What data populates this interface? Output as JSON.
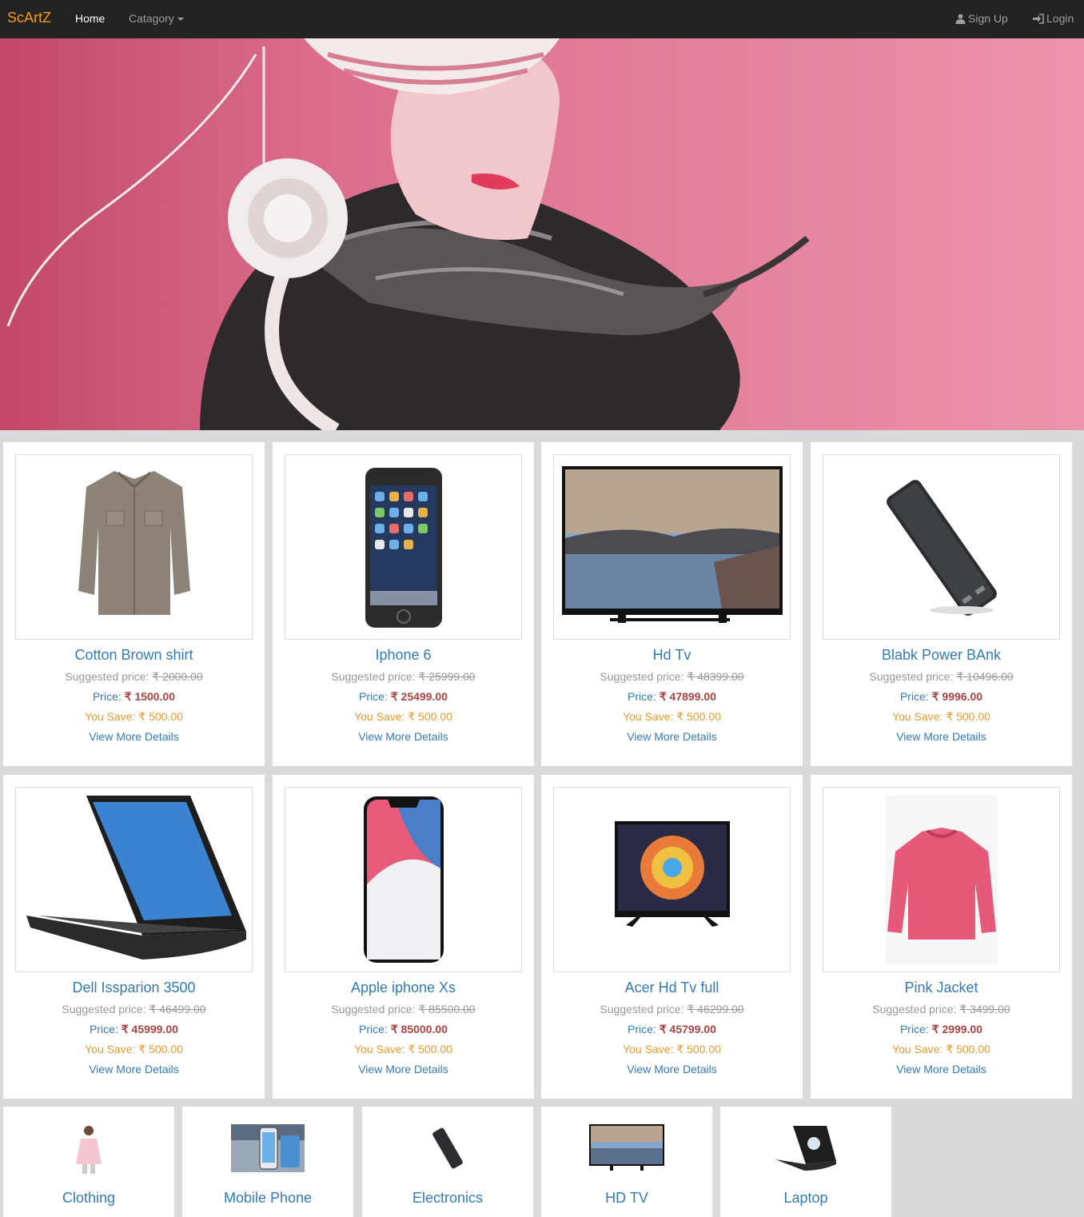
{
  "navbar": {
    "brand": "ScArtZ",
    "home": "Home",
    "category": "Catagory",
    "signup": "Sign Up",
    "login": "Login"
  },
  "hero": {
    "slide_count": 4,
    "active_slide": 0
  },
  "labels": {
    "suggested": "Suggested price:",
    "price": "Price:",
    "save": "You Save:",
    "more": "View More Details"
  },
  "products": [
    {
      "name": "Cotton Brown shirt",
      "suggested": "₹ 2000.00",
      "price": "₹ 1500.00",
      "save": "₹ 500.00",
      "icon": "shirt-image"
    },
    {
      "name": "Iphone 6",
      "suggested": "₹ 25999.00",
      "price": "₹ 25499.00",
      "save": "₹ 500.00",
      "icon": "phone-image"
    },
    {
      "name": "Hd Tv",
      "suggested": "₹ 48399.00",
      "price": "₹ 47899.00",
      "save": "₹ 500.00",
      "icon": "tv-image"
    },
    {
      "name": "Blabk Power BAnk",
      "suggested": "₹ 10496.00",
      "price": "₹ 9996.00",
      "save": "₹ 500.00",
      "icon": "powerbank-image"
    },
    {
      "name": "Dell Issparion 3500",
      "suggested": "₹ 46499.00",
      "price": "₹ 45999.00",
      "save": "₹ 500.00",
      "icon": "laptop-image"
    },
    {
      "name": "Apple iphone Xs",
      "suggested": "₹ 85500.00",
      "price": "₹ 85000.00",
      "save": "₹ 500.00",
      "icon": "iphone-x-image"
    },
    {
      "name": "Acer Hd Tv full",
      "suggested": "₹ 46299.00",
      "price": "₹ 45799.00",
      "save": "₹ 500.00",
      "icon": "tv-image"
    },
    {
      "name": "Pink Jacket",
      "suggested": "₹ 3499.00",
      "price": "₹ 2999.00",
      "save": "₹ 500.00",
      "icon": "jacket-image"
    }
  ],
  "categories": [
    {
      "label": "Clothing"
    },
    {
      "label": "Mobile Phone"
    },
    {
      "label": "Electronics"
    },
    {
      "label": "HD TV"
    },
    {
      "label": "Laptop"
    }
  ],
  "colors": {
    "brand": "#f39c12",
    "link": "#337ab7",
    "price": "#a94442",
    "save": "#e69a2e",
    "navbar": "#222222",
    "hero_bg": "#e68fa8"
  }
}
